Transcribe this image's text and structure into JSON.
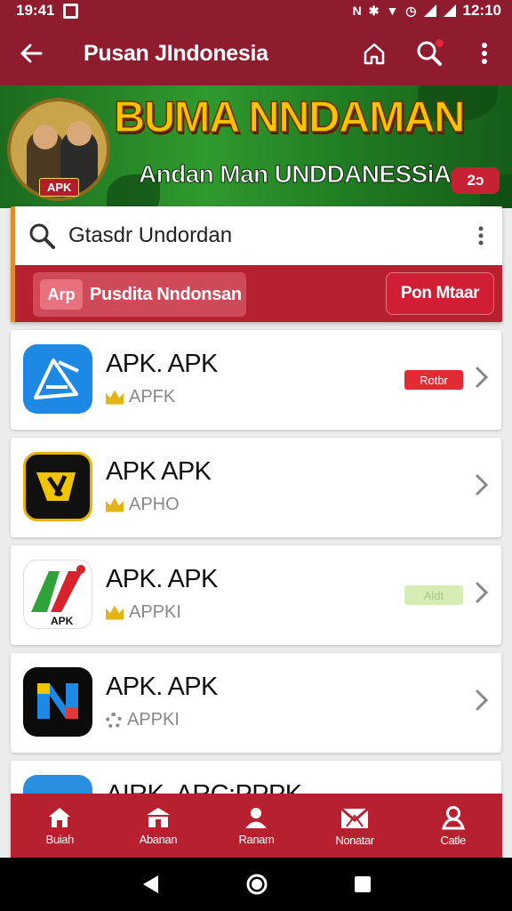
{
  "status_bar": {
    "time_left": "19:41",
    "time_right": "12:10",
    "icons": [
      "gallery-icon",
      "nfc-icon",
      "bluetooth-icon",
      "wifi-icon",
      "alarm-icon",
      "signal-icon",
      "battery-icon"
    ]
  },
  "app_bar": {
    "title": "Pusan JIndonesia",
    "icons": [
      "back-arrow-icon",
      "home-icon",
      "search-icon",
      "more-vert-icon"
    ]
  },
  "banner": {
    "headline": "BUMA NNDAMAN",
    "subline": "Andan Man UNDDANESSiA",
    "ribbon": "APK",
    "badge": "2ɔ"
  },
  "search": {
    "value": "Gtasdr Undordan"
  },
  "promo": {
    "chip_tag": "Arp",
    "chip_label": "Pusdita Nndonsan",
    "button": "Pon Mtaar"
  },
  "apps": [
    {
      "name": "APK. APK",
      "meta": "APFK",
      "meta_icon": "crown-icon",
      "tag": "Rotbr",
      "tag_bg": "#e22b35",
      "tag_fg": "#ffffff",
      "icon": "apk-blue-icon"
    },
    {
      "name": "APK APK",
      "meta": "APHO",
      "meta_icon": "crown-icon",
      "tag": "",
      "icon": "apk-black-yellow-icon"
    },
    {
      "name": "APK. APK",
      "meta": "APPKI",
      "meta_icon": "crown-icon",
      "tag": "Aldt",
      "tag_bg": "#d6ecb5",
      "tag_fg": "#a6c98a",
      "icon": "apk-green-icon"
    },
    {
      "name": "APK. APK",
      "meta": "APPKI",
      "meta_icon": "gear-icon",
      "tag": "",
      "icon": "apk-gradient-icon"
    },
    {
      "name": "AIRK. ARC:PPPK",
      "meta": "",
      "meta_icon": "",
      "tag": "",
      "icon": "apk-blue-cloud-icon"
    }
  ],
  "bottom_nav": [
    {
      "label": "Buiah",
      "icon": "home-icon"
    },
    {
      "label": "Abanan",
      "icon": "store-icon"
    },
    {
      "label": "Ranam",
      "icon": "person-icon"
    },
    {
      "label": "Nonatar",
      "icon": "mail-icon"
    },
    {
      "label": "Catle",
      "icon": "profile-icon"
    }
  ],
  "colors": {
    "primary": "#8f1c2e",
    "accent": "#b7202f",
    "banner_green": "#2f9a2d",
    "headline_gold": "#f5c400"
  }
}
